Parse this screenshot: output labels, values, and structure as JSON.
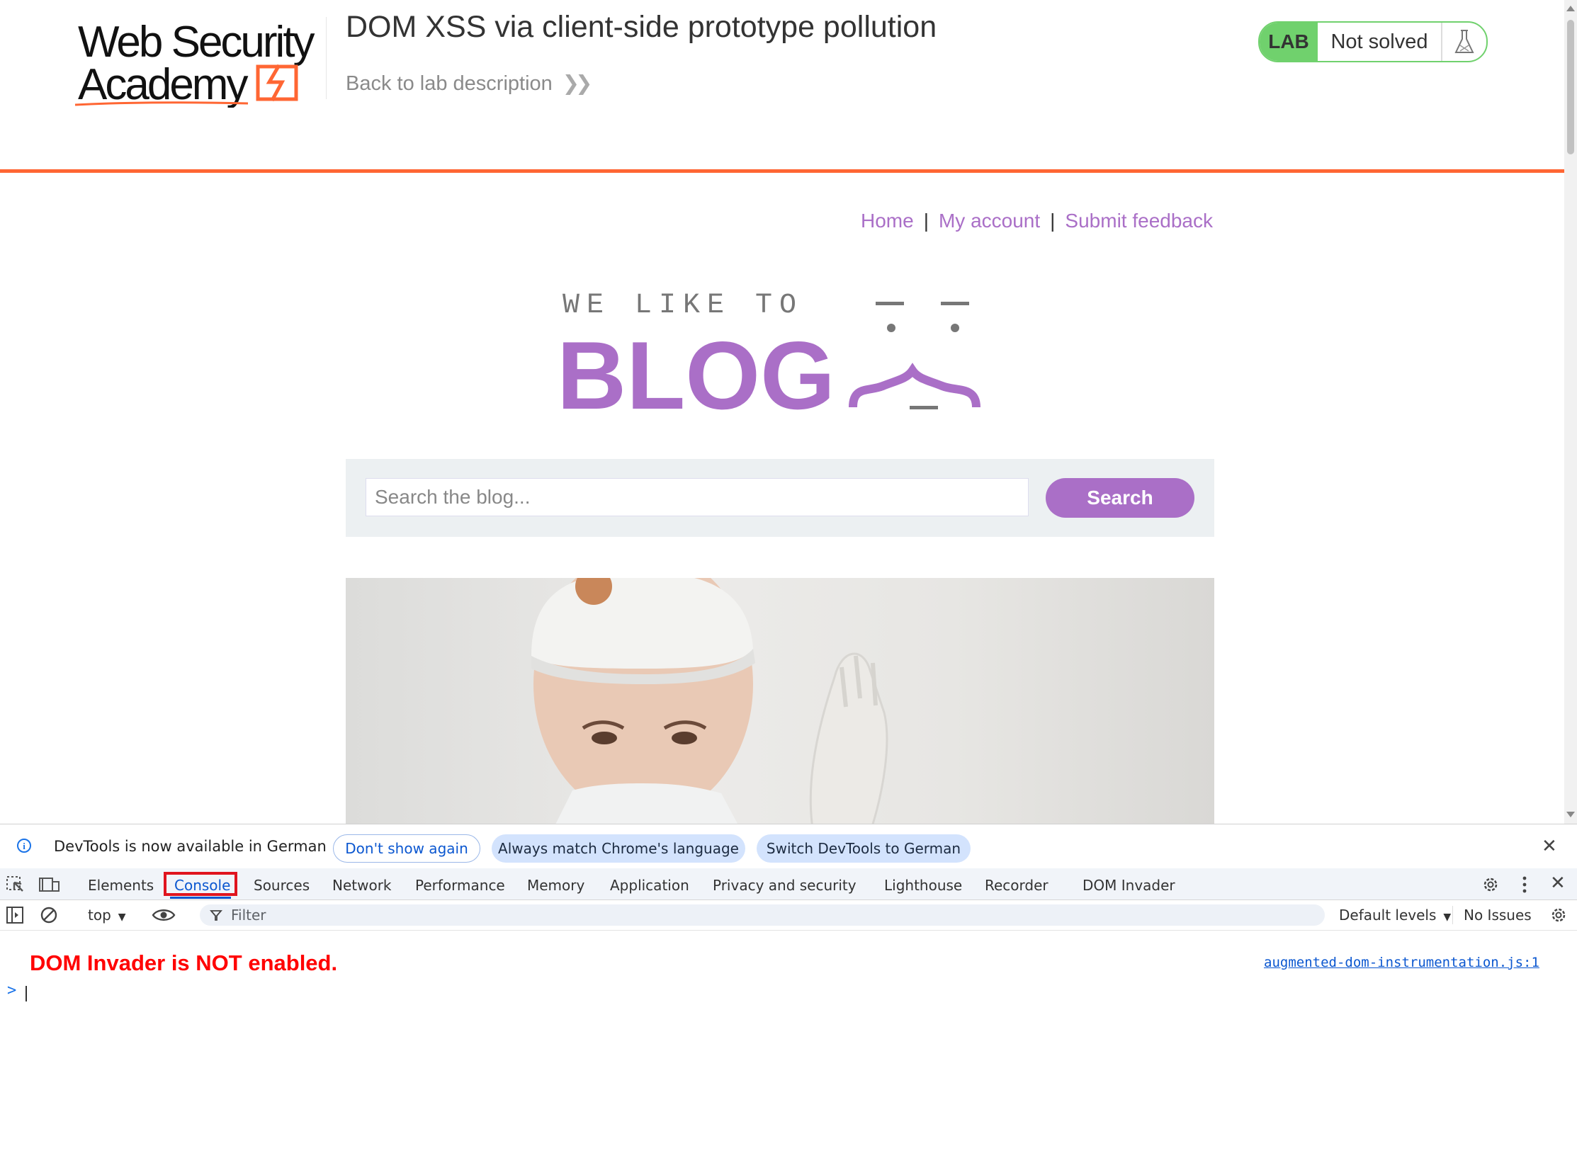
{
  "header": {
    "logo_line1": "Web Security",
    "logo_line2": "Academy",
    "lab_title": "DOM XSS via client-side prototype pollution",
    "back_link": "Back to lab description",
    "lab_badge": "LAB",
    "lab_status": "Not solved"
  },
  "nav": {
    "items": [
      "Home",
      "My account",
      "Submit feedback"
    ],
    "separator": "|"
  },
  "blog_logo": {
    "tagline": "WE LIKE TO",
    "word": "BLOG"
  },
  "search": {
    "placeholder": "Search the blog...",
    "button": "Search"
  },
  "colors": {
    "accent": "#aa6fc7",
    "orange": "#ff6633",
    "lab_green": "#70d16d",
    "error_red": "#ff0000",
    "devtools_blue": "#0b57d0"
  },
  "devtools": {
    "infobar": {
      "message": "DevTools is now available in German",
      "dont_show": "Don't show again",
      "always_match": "Always match Chrome's language",
      "switch": "Switch DevTools to German"
    },
    "tabs": [
      "Elements",
      "Console",
      "Sources",
      "Network",
      "Performance",
      "Memory",
      "Application",
      "Privacy and security",
      "Lighthouse",
      "Recorder",
      "DOM Invader"
    ],
    "active_tab": "Console",
    "toolbar": {
      "context": "top",
      "filter_placeholder": "Filter",
      "levels": "Default levels",
      "issues": "No Issues"
    },
    "console": {
      "message": "DOM Invader is NOT enabled.",
      "source": "augmented-dom-instrumentation.js:1",
      "prompt": ">"
    }
  }
}
